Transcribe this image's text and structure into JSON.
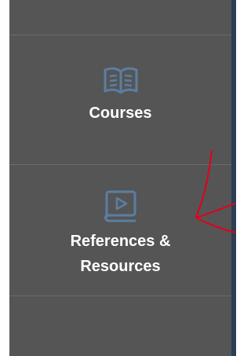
{
  "sidebar": {
    "items": [
      {
        "label": "Courses",
        "icon": "open-book-icon"
      },
      {
        "label_lines": [
          "References &",
          "Resources"
        ],
        "icon": "video-book-icon"
      }
    ]
  },
  "colors": {
    "sidebar_bg": "#555555",
    "divider": "#6b6b6b",
    "icon_accent": "#5b7ea3",
    "text": "#ffffff",
    "right_strip": "#2b3f54",
    "annotation": "#e3001b"
  }
}
